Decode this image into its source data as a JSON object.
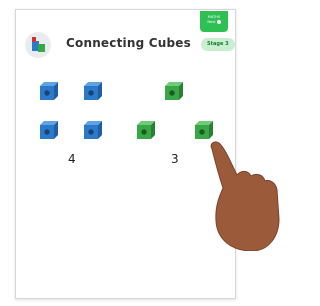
{
  "lesson": {
    "title": "Connecting Cubes",
    "stage_badge": "Stage 3",
    "corner_label": "MATHS",
    "corner_sub": "Next"
  },
  "groups": [
    {
      "name": "blue",
      "color": "#2b79c9",
      "count": "4"
    },
    {
      "name": "green",
      "color": "#3aa746",
      "count": "3"
    }
  ],
  "icons": {
    "logo": "connecting-cubes-icon",
    "hand": "pointing-hand-icon"
  }
}
